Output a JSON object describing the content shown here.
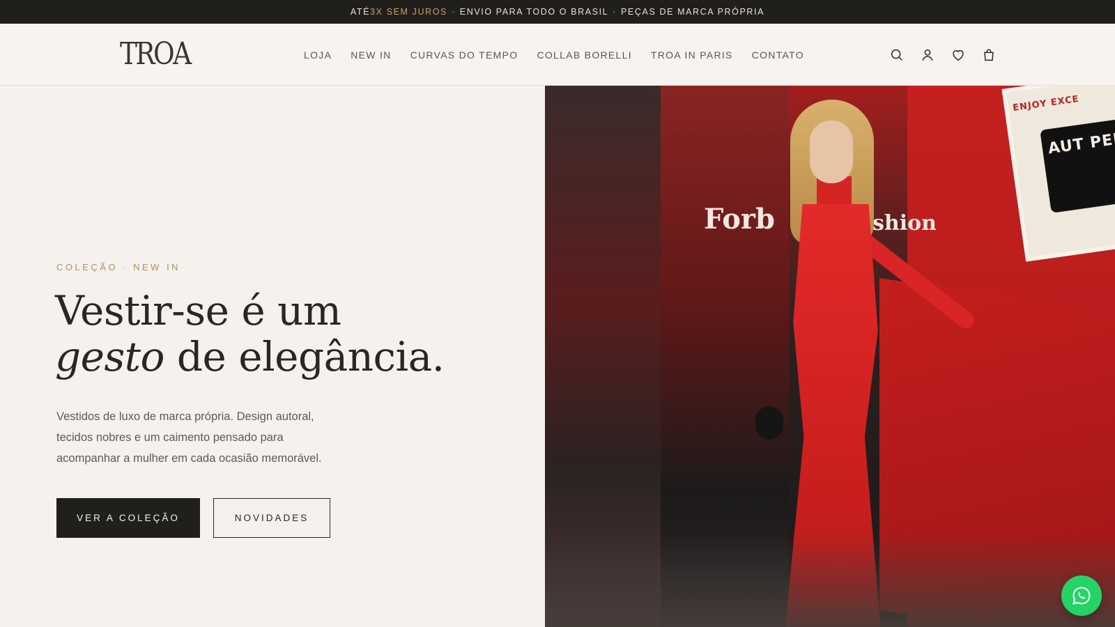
{
  "announcement": {
    "prefix": "ATÉ ",
    "highlight": "3X SEM JUROS",
    "part2": "ENVIO PARA TODO O BRASIL",
    "part3": "PEÇAS DE MARCA PRÓPRIA",
    "separator": "·"
  },
  "brand": {
    "logo_text": "TROA"
  },
  "nav": [
    {
      "label": "LOJA"
    },
    {
      "label": "NEW IN"
    },
    {
      "label": "CURVAS DO TEMPO"
    },
    {
      "label": "COLLAB BORELLI"
    },
    {
      "label": "TROA IN PARIS"
    },
    {
      "label": "CONTATO"
    }
  ],
  "header_icons": [
    "search-icon",
    "account-icon",
    "heart-icon",
    "bag-icon"
  ],
  "hero": {
    "eyebrow": "COLEÇÃO · NEW IN",
    "headline_line1": "Vestir-se é um",
    "headline_italic": "gesto",
    "headline_rest": " de elegância.",
    "description": "Vestidos de luxo de marca própria. Design autoral, tecidos nobres e um caimento pensado para acompanhar a mulher em cada ocasião memorável.",
    "primary_cta": "VER A COLEÇÃO",
    "secondary_cta": "NOVIDADES"
  },
  "photo": {
    "backdrop_text_1": "Forb",
    "backdrop_text_2": "shion",
    "poster_text": "ENJOY EXCE",
    "poster_dark_text": "AUT PER"
  },
  "colors": {
    "announcement_bg": "#211f1c",
    "accent": "#c9a467",
    "page_bg": "#f5f2ee",
    "primary_button": "#211f1c",
    "whatsapp": "#25d366"
  }
}
